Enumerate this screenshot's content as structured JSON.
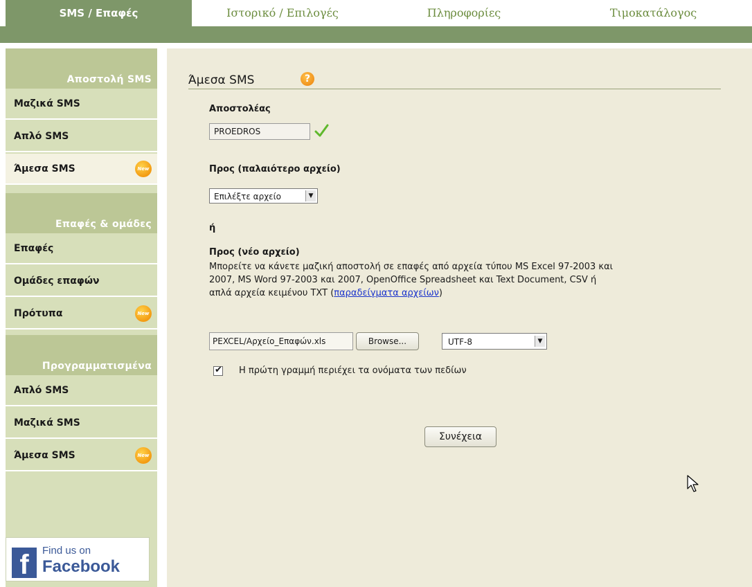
{
  "nav": {
    "tabs": [
      {
        "label": "SMS / Επαφές"
      },
      {
        "label": "Ιστορικό / Επιλογές"
      },
      {
        "label": "Πληροφορίες"
      },
      {
        "label": "Τιμοκατάλογος"
      }
    ],
    "active_color": "#7e9769"
  },
  "sidebar": {
    "sections": [
      {
        "title": "Αποστολή SMS",
        "items": [
          {
            "label": "Μαζικά SMS"
          },
          {
            "label": "Απλό SMS"
          },
          {
            "label": "Άμεσα SMS",
            "badge": "New",
            "current": true
          }
        ]
      },
      {
        "title": "Επαφές & ομάδες",
        "items": [
          {
            "label": "Επαφές"
          },
          {
            "label": "Ομάδες επαφών"
          },
          {
            "label": "Πρότυπα",
            "badge": "New"
          }
        ]
      },
      {
        "title": "Προγραμματισμένα",
        "items": [
          {
            "label": "Απλό SMS"
          },
          {
            "label": "Μαζικά SMS"
          },
          {
            "label": "Άμεσα SMS",
            "badge": "New"
          }
        ]
      }
    ],
    "facebook": {
      "line1": "Find us on",
      "line2": "Facebook"
    }
  },
  "main": {
    "title": "Άμεσα SMS",
    "help_icon": "?",
    "sender_label": "Αποστολέας",
    "sender_value": "PROEDROS",
    "old_file_label": "Προς (παλαιότερο αρχείο)",
    "old_file_select": "Επιλέξτε αρχείο",
    "or_text": "ή",
    "new_file_label": "Προς (νέο αρχείο)",
    "description_1": "Μπορείτε να κάνετε μαζική αποστολή σε επαφές από αρχεία τύπου MS Excel 97-2003 και",
    "description_2": "2007, MS Word 97-2003 και 2007, OpenOffice Spreadsheet και Text Document, CSV ή",
    "description_3a": "απλά αρχεία κειμένου TXT (",
    "description_link": "παραδείγματα αρχείων",
    "description_3b": ")",
    "file_path": "PEXCEL/Αρχείο_Επαφών.xls",
    "browse_label": "Browse...",
    "encoding": "UTF-8",
    "header_checkbox_label": "Η πρώτη γραμμή περιέχει τα ονόματα των πεδίων",
    "header_checkbox_checked": true,
    "continue_label": "Συνέχεια"
  }
}
